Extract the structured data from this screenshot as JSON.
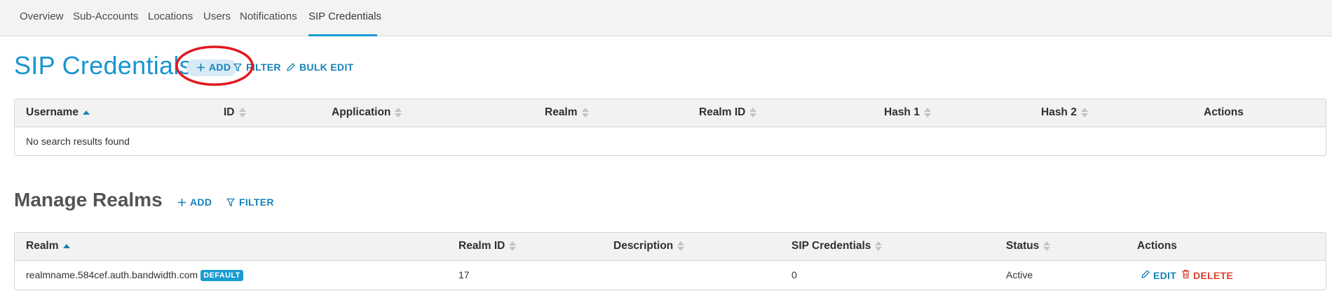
{
  "nav": {
    "tabs": [
      {
        "label": "Overview"
      },
      {
        "label": "Sub-Accounts"
      },
      {
        "label": "Locations"
      },
      {
        "label": "Users"
      },
      {
        "label": "Notifications"
      },
      {
        "label": "SIP Credentials"
      }
    ],
    "active_tab": "SIP Credentials"
  },
  "sip_credentials": {
    "title": "SIP Credentials",
    "add_label": "ADD",
    "filter_label": "FILTER",
    "bulk_edit_label": "BULK EDIT",
    "columns": [
      "Username",
      "ID",
      "Application",
      "Realm",
      "Realm ID",
      "Hash 1",
      "Hash 2",
      "Actions"
    ],
    "sorted_column": "Username",
    "empty_message": "No search results found"
  },
  "manage_realms": {
    "title": "Manage Realms",
    "add_label": "ADD",
    "filter_label": "FILTER",
    "columns": [
      "Realm",
      "Realm ID",
      "Description",
      "SIP Credentials",
      "Status",
      "Actions"
    ],
    "sorted_column": "Realm",
    "rows": [
      {
        "realm": "realmname.584cef.auth.bandwidth.com",
        "badge": "DEFAULT",
        "realm_id": "17",
        "description": "",
        "sip_credentials": "0",
        "status": "Active",
        "edit_label": "EDIT",
        "delete_label": "DELETE"
      }
    ]
  },
  "colors": {
    "accent": "#1a94d0",
    "link": "#1482b8",
    "danger": "#d9412e",
    "annotation": "#e0181e"
  }
}
